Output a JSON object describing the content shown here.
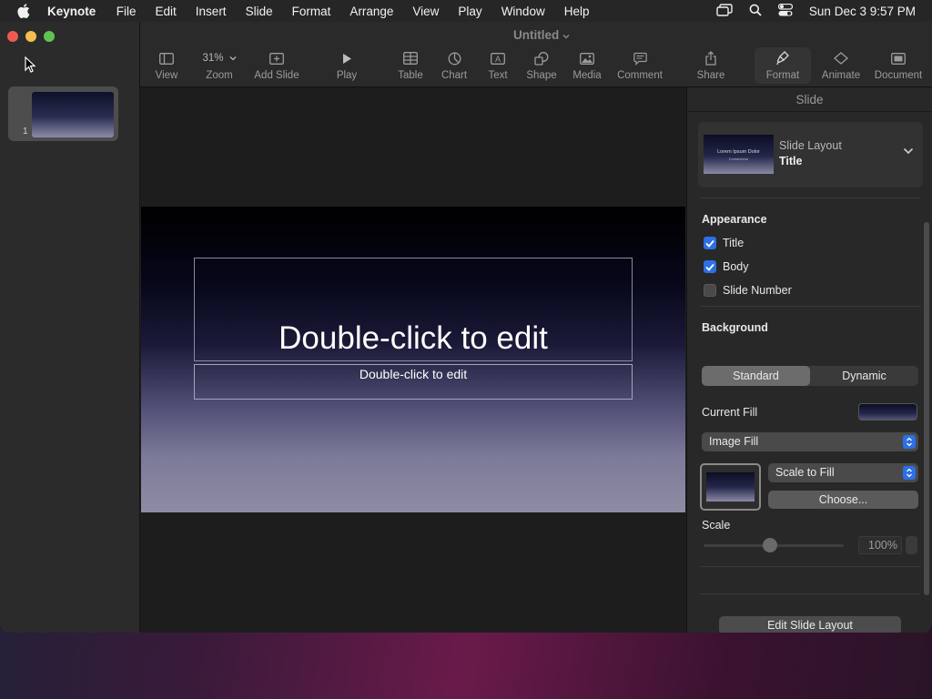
{
  "menubar": {
    "app": "Keynote",
    "items": [
      "File",
      "Edit",
      "Insert",
      "Slide",
      "Format",
      "Arrange",
      "View",
      "Play",
      "Window",
      "Help"
    ],
    "datetime": "Sun Dec 3  9:57 PM"
  },
  "window": {
    "title": "Untitled"
  },
  "toolbar": {
    "view": "View",
    "zoom_value": "31%",
    "zoom": "Zoom",
    "add_slide": "Add Slide",
    "play": "Play",
    "table": "Table",
    "chart": "Chart",
    "text": "Text",
    "shape": "Shape",
    "media": "Media",
    "comment": "Comment",
    "share": "Share",
    "format": "Format",
    "animate": "Animate",
    "document": "Document"
  },
  "navigator": {
    "slides": [
      {
        "number": "1"
      }
    ]
  },
  "slide": {
    "title_placeholder": "Double-click to edit",
    "body_placeholder": "Double-click to edit"
  },
  "inspector": {
    "header": "Slide",
    "layout_label": "Slide Layout",
    "layout_value": "Title",
    "layout_thumb_title": "Lorem Ipsum Dolor",
    "layout_thumb_sub": "Consectetur",
    "appearance_label": "Appearance",
    "appearance_options": [
      {
        "label": "Title",
        "checked": true
      },
      {
        "label": "Body",
        "checked": true
      },
      {
        "label": "Slide Number",
        "checked": false
      }
    ],
    "background_label": "Background",
    "background_modes": [
      "Standard",
      "Dynamic"
    ],
    "background_selected": "Standard",
    "current_fill_label": "Current Fill",
    "fill_type": "Image Fill",
    "scale_mode": "Scale to Fill",
    "choose_button": "Choose...",
    "scale_label": "Scale",
    "scale_value": "100%",
    "edit_layout_button": "Edit Slide Layout"
  },
  "colors": {
    "accent": "#2c6fe6",
    "close": "#ee5a52",
    "minimize": "#f4bf4f",
    "maximize": "#5fc454"
  }
}
